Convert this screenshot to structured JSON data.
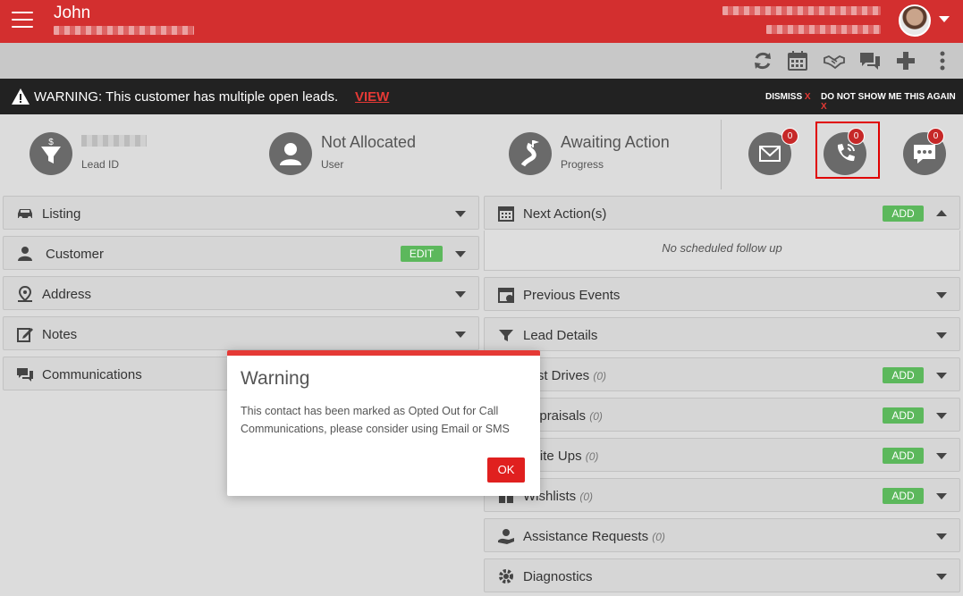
{
  "header": {
    "user_name": "John",
    "menu_icon": "hamburger-icon",
    "avatar_icon": "avatar-icon"
  },
  "toolbar": {
    "icons": [
      "refresh-icon",
      "calendar-icon",
      "handshake-icon",
      "chat-icon",
      "plus-icon",
      "more-vertical-icon"
    ]
  },
  "warning_bar": {
    "message": "WARNING: This customer has multiple open leads.",
    "view_link": "VIEW",
    "dismiss": "DISMISS",
    "dont_show": "DO NOT SHOW ME THIS AGAIN",
    "close_mark": "X"
  },
  "summary": {
    "lead_id_label": "Lead ID",
    "user_value": "Not Allocated",
    "user_label": "User",
    "progress_value": "Awaiting Action",
    "progress_label": "Progress",
    "email_count": "0",
    "call_count": "0",
    "sms_count": "0"
  },
  "left_panels": {
    "listing": "Listing",
    "customer": "Customer",
    "customer_edit": "EDIT",
    "address": "Address",
    "notes": "Notes",
    "communications": "Communications"
  },
  "right_panels": {
    "next_actions": "Next Action(s)",
    "next_actions_add": "ADD",
    "no_scheduled": "No scheduled follow up",
    "previous_events": "Previous Events",
    "lead_details": "Lead Details",
    "test_drives": "Test Drives",
    "test_drives_count": "(0)",
    "appraisals": "Appraisals",
    "appraisals_count": "(0)",
    "write_ups": "Write Ups",
    "write_ups_count": "(0)",
    "wishlists": "Wishlists",
    "wishlists_count": "(0)",
    "assistance_requests": "Assistance Requests",
    "assistance_requests_count": "(0)",
    "diagnostics": "Diagnostics",
    "add_label": "ADD"
  },
  "modal": {
    "title": "Warning",
    "body": "This contact has been marked as Opted Out for Call Communications, please consider using Email or SMS",
    "ok": "OK"
  },
  "colors": {
    "brand_red": "#d32f2f",
    "warning_bar": "#222222",
    "add_green": "#5cb85c",
    "badge_red": "#c62828"
  }
}
